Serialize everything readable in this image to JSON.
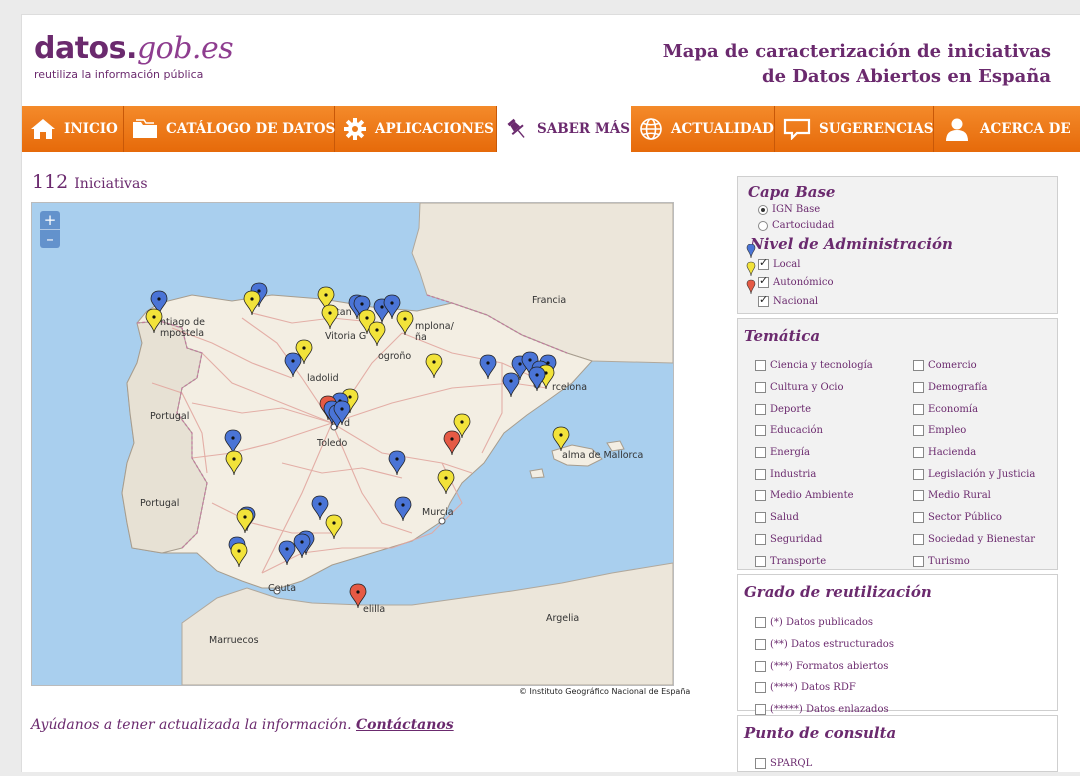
{
  "logo": {
    "name_main": "datos.",
    "name_domain": "gob.es",
    "tagline": "reutiliza la información pública"
  },
  "title": {
    "line1": "Mapa de caracterización de iniciativas",
    "line2": "de Datos Abiertos en España"
  },
  "nav": [
    {
      "label": "INICIO",
      "icon": "home-icon"
    },
    {
      "label": "CATÁLOGO DE DATOS",
      "icon": "folder-icon"
    },
    {
      "label": "APLICACIONES",
      "icon": "gear-icon"
    },
    {
      "label": "SABER MÁS",
      "icon": "pushpin-icon",
      "active": true
    },
    {
      "label": "ACTUALIDAD",
      "icon": "globe-icon"
    },
    {
      "label": "SUGERENCIAS",
      "icon": "speech-bubble-icon"
    },
    {
      "label": "ACERCA DE",
      "icon": "person-icon"
    }
  ],
  "count": {
    "number": "112",
    "label": "Iniciativas"
  },
  "map": {
    "zoom_in": "+",
    "zoom_out": "–",
    "attribution": "© Instituto Geográfico Nacional de España",
    "labels": {
      "francia": "Francia",
      "portugal_n": "Portugal",
      "portugal_s": "Portugal",
      "argelia": "Argelia",
      "marruecos": "Marruecos",
      "ceuta": "Ceuta",
      "melilla": "elilla",
      "santiago1": "ntiago de",
      "santiago2": "mpostela",
      "vitoria": "Vitoria G",
      "pamplona": "mplona/",
      "pamplona2": "ña",
      "logrono": "ogroño",
      "valladolid": "ladolid",
      "madrid": "d",
      "toledo": "Toledo",
      "barcelona": "rcelona",
      "palma": "alma de Mallorca",
      "murcia": "Murcia",
      "santander": "ntan"
    },
    "marker_colors": {
      "blue": "#4a74d6",
      "yellow": "#f2e33a",
      "red": "#e55a45"
    }
  },
  "help": {
    "text": "Ayúdanos a tener actualizada la información.",
    "link": "Contáctanos"
  },
  "capa_base": {
    "title": "Capa Base",
    "options": [
      {
        "label": "IGN Base",
        "checked": true
      },
      {
        "label": "Cartociudad",
        "checked": false
      }
    ]
  },
  "nivel": {
    "title": "Nivel de Administración",
    "options": [
      {
        "label": "Local",
        "color": "#4a74d6",
        "checked": true
      },
      {
        "label": "Autonómico",
        "color": "#f2e33a",
        "checked": true
      },
      {
        "label": "Nacional",
        "color": "#e55a45",
        "checked": true
      }
    ]
  },
  "tematica": {
    "title": "Temática",
    "left": [
      "Ciencia y tecnología",
      "Cultura y Ocio",
      "Deporte",
      "Educación",
      "Energía",
      "Industria",
      "Medio Ambiente",
      "Salud",
      "Seguridad",
      "Transporte"
    ],
    "right": [
      "Comercio",
      "Demografía",
      "Economía",
      "Empleo",
      "Hacienda",
      "Legislación y Justicia",
      "Medio Rural",
      "Sector Público",
      "Sociedad y Bienestar",
      "Turismo"
    ]
  },
  "grado": {
    "title": "Grado de reutilización",
    "options": [
      "(*) Datos publicados",
      "(**) Datos estructurados",
      "(***) Formatos abiertos",
      "(****) Datos RDF",
      "(*****) Datos enlazados"
    ]
  },
  "punto": {
    "title": "Punto de consulta",
    "options": [
      "SPARQL"
    ]
  }
}
